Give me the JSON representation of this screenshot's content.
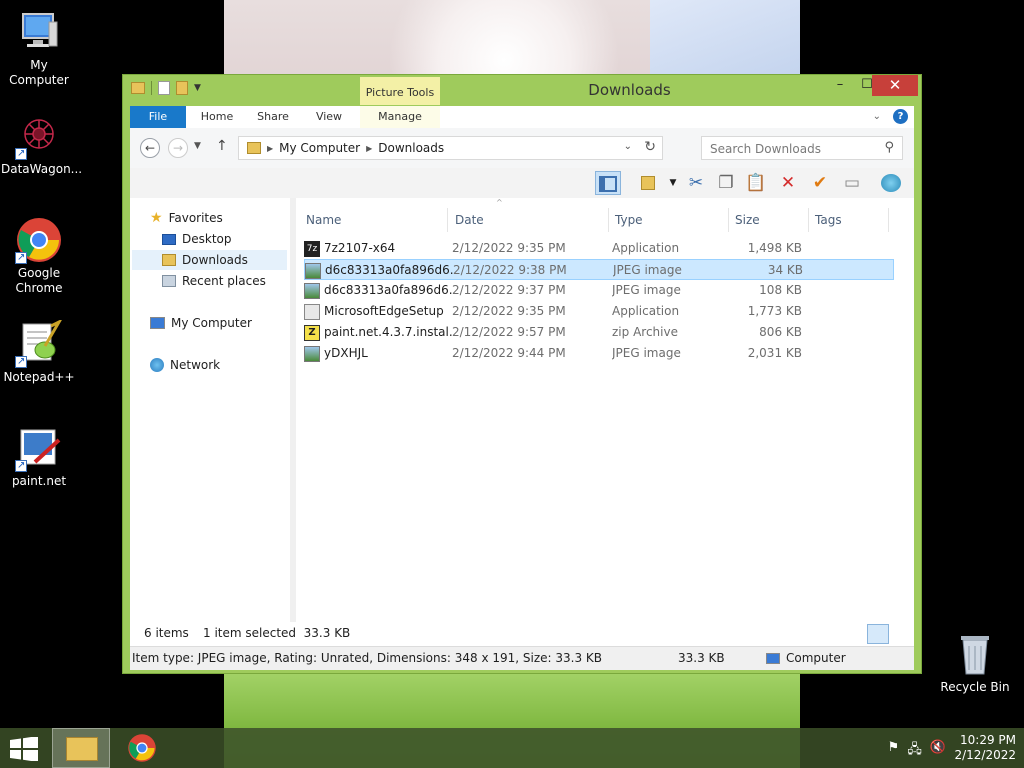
{
  "desktop": {
    "icons": [
      {
        "label": "My Computer"
      },
      {
        "label": "DataWagon..."
      },
      {
        "label": "Google Chrome"
      },
      {
        "label": "Notepad++"
      },
      {
        "label": "paint.net"
      },
      {
        "label": "Recycle Bin"
      }
    ]
  },
  "window": {
    "title": "Downloads",
    "contextual_tab_group": "Picture Tools",
    "tabs": [
      {
        "label": "File"
      },
      {
        "label": "Home"
      },
      {
        "label": "Share"
      },
      {
        "label": "View"
      },
      {
        "label": "Manage"
      }
    ],
    "controls": {
      "minimize": "–",
      "maximize": "☐",
      "close": "✕"
    },
    "help": "?"
  },
  "address": {
    "crumbs": [
      "My Computer",
      "Downloads"
    ],
    "search_placeholder": "Search Downloads"
  },
  "nav_pane": {
    "favorites": "Favorites",
    "favorites_items": [
      "Desktop",
      "Downloads",
      "Recent places"
    ],
    "computer": "My Computer",
    "network": "Network",
    "selected": "Downloads"
  },
  "columns": [
    "Name",
    "Date",
    "Type",
    "Size",
    "Tags"
  ],
  "files": [
    {
      "name": "7z2107-x64",
      "date": "2/12/2022 9:35 PM",
      "type": "Application",
      "size": "1,498 KB",
      "icon": "7zip-icon"
    },
    {
      "name": "d6c83313a0fa896d6...",
      "date": "2/12/2022 9:38 PM",
      "type": "JPEG image",
      "size": "34 KB",
      "icon": "jpeg-icon",
      "selected": true
    },
    {
      "name": "d6c83313a0fa896d6...",
      "date": "2/12/2022 9:37 PM",
      "type": "JPEG image",
      "size": "108 KB",
      "icon": "jpeg-icon"
    },
    {
      "name": "MicrosoftEdgeSetup",
      "date": "2/12/2022 9:35 PM",
      "type": "Application",
      "size": "1,773 KB",
      "icon": "app-icon"
    },
    {
      "name": "paint.net.4.3.7.instal...",
      "date": "2/12/2022 9:57 PM",
      "type": "zip Archive",
      "size": "806 KB",
      "icon": "zip-icon"
    },
    {
      "name": "yDXHJL",
      "date": "2/12/2022 9:44 PM",
      "type": "JPEG image",
      "size": "2,031 KB",
      "icon": "jpeg-icon"
    }
  ],
  "status": {
    "items_count": "6 items",
    "selection": "1 item selected  33.3 KB"
  },
  "info_bar": {
    "details": "Item type: JPEG image, Rating: Unrated, Dimensions: 348 x 191, Size: 33.3 KB",
    "size": "33.3 KB",
    "location": "Computer"
  },
  "taskbar": {
    "time": "10:29 PM",
    "date": "2/12/2022"
  },
  "colors": {
    "window_frame": "#9fcb5c",
    "file_tab": "#1979ca",
    "close_button": "#c7403a",
    "selection": "#cce8ff",
    "contextual_tab": "#f3f0a6"
  }
}
